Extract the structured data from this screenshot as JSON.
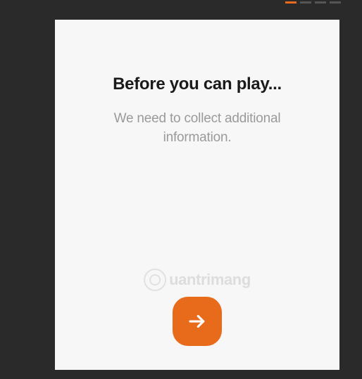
{
  "progress": {
    "steps": 4,
    "active_index": 0
  },
  "card": {
    "title": "Before you can play...",
    "subtitle": "We need to collect additional information."
  },
  "button": {
    "icon_name": "arrow-right-icon"
  },
  "watermark": {
    "text": "uantrimang"
  },
  "colors": {
    "accent": "#e86b1c",
    "background": "#2a2a2a",
    "card_bg": "#f7f7f7",
    "title": "#1a1a1a",
    "subtitle": "#9a9a9a"
  }
}
